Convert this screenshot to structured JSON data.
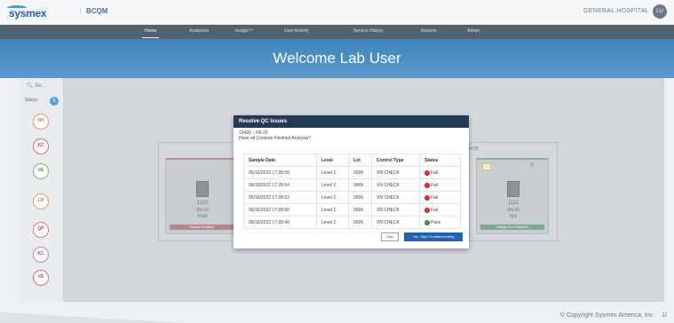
{
  "header": {
    "brand": "sysmex",
    "app_name": "BCQM",
    "hospital": "GENERAL HOSPITAL",
    "user_initials": "LU"
  },
  "nav": {
    "items": [
      "Home",
      "Analyzers",
      "Insight™",
      "User Activity",
      "Service History",
      "Reports",
      "Admin"
    ],
    "active": "Home"
  },
  "hero": {
    "title": "Welcome Lab User"
  },
  "sidebar": {
    "search_placeholder": "Se...",
    "site_label": "Site(s)",
    "site_count": "5",
    "sites": [
      "NH",
      "KC",
      "VE",
      "LD",
      "QP",
      "KC",
      "VE"
    ]
  },
  "background_cards": {
    "left": {
      "code": "1110",
      "model": "XN-10",
      "user": "Fred",
      "status": "Service Notified"
    },
    "right": {
      "code": "1111",
      "model": "XN-10",
      "user": "Kim",
      "status": "Ready For Samples",
      "count": "0",
      "group_label": "el 32"
    }
  },
  "dialog": {
    "title": "Resolve QC Issues",
    "subtitle_line1": "13490 - XN-20",
    "subtitle_line2": "Have all Controls Finished Analysis?",
    "columns": [
      "Sample Date",
      "Level",
      "Lot",
      "Control Type",
      "Status"
    ],
    "rows": [
      {
        "date": "06/16/2022 17:28:56",
        "level": "Level 2",
        "lot": "0006",
        "type": "XN CHECK",
        "status": "Fail"
      },
      {
        "date": "06/16/2022 17:28:54",
        "level": "Level 2",
        "lot": "0006",
        "type": "XN CHECK",
        "status": "Fail"
      },
      {
        "date": "06/16/2022 17:28:52",
        "level": "Level 2",
        "lot": "0006",
        "type": "XN CHECK",
        "status": "Fail"
      },
      {
        "date": "06/16/2022 17:28:50",
        "level": "Level 2",
        "lot": "0006",
        "type": "XN CHECK",
        "status": "Fail"
      },
      {
        "date": "06/16/2022 17:28:40",
        "level": "Level 2",
        "lot": "0006",
        "type": "XN CHECK",
        "status": "Pass"
      }
    ],
    "skip_label": "Skip",
    "start_label": "Yes, Start Troubleshooting"
  },
  "footer": {
    "copyright": "© Copyright Sysmex America, Inc.",
    "page_number": "1/"
  },
  "colors": {
    "header_dark": "#233a56",
    "accent_blue": "#1f61b2",
    "fail_red": "#d81f26",
    "pass_green": "#2e8d3b",
    "hero_blue": "#4a8cc3"
  }
}
